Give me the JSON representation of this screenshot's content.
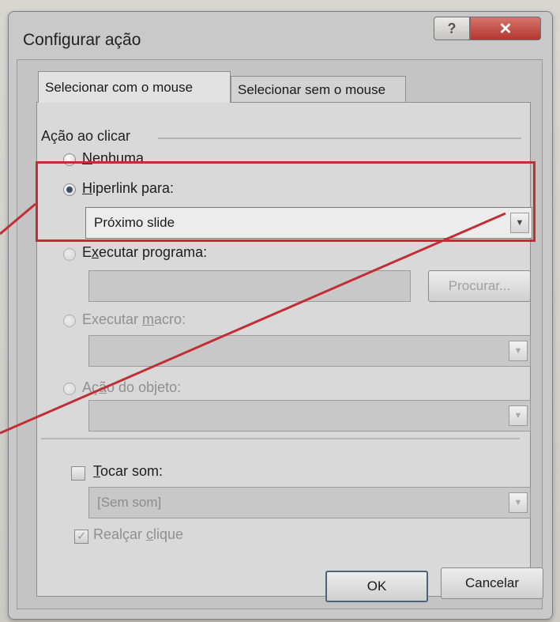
{
  "dialog": {
    "title": "Configurar ação",
    "help_glyph": "?",
    "close_glyph": "✕"
  },
  "tabs": [
    {
      "label": "Selecionar com o mouse",
      "active": true
    },
    {
      "label": "Selecionar sem o mouse",
      "active": false
    }
  ],
  "group": {
    "label": "Ação ao clicar"
  },
  "options": {
    "none": {
      "label_prefix": "",
      "label_u": "N",
      "label_rest": "enhuma",
      "selected": false
    },
    "hyperlink": {
      "label_prefix": "",
      "label_u": "H",
      "label_rest": "iperlink para:",
      "selected": true,
      "value": "Próximo slide"
    },
    "run_program": {
      "label_prefix": "E",
      "label_u": "x",
      "label_rest": "ecutar programa:",
      "selected": false,
      "value": ""
    },
    "run_macro": {
      "label_prefix": "Executar ",
      "label_u": "m",
      "label_rest": "acro:",
      "selected": false,
      "value": ""
    },
    "object_action": {
      "label_prefix": "Aç",
      "label_u": "ã",
      "label_rest": "o do objeto:",
      "selected": false,
      "value": ""
    }
  },
  "browse_button": {
    "label_u": "P",
    "label_rest": "rocurar..."
  },
  "play_sound": {
    "label_u": "T",
    "label_rest": "ocar som:",
    "checked": false,
    "value": "[Sem som]"
  },
  "highlight_click": {
    "label_prefix": "Realçar ",
    "label_u": "c",
    "label_rest": "lique",
    "checked": true
  },
  "footer": {
    "ok_label": "OK",
    "cancel_label": "Cancelar"
  },
  "colors": {
    "annotation": "#c12e36",
    "accent": "#4e6279"
  },
  "icons": {
    "dropdown": "▼"
  }
}
